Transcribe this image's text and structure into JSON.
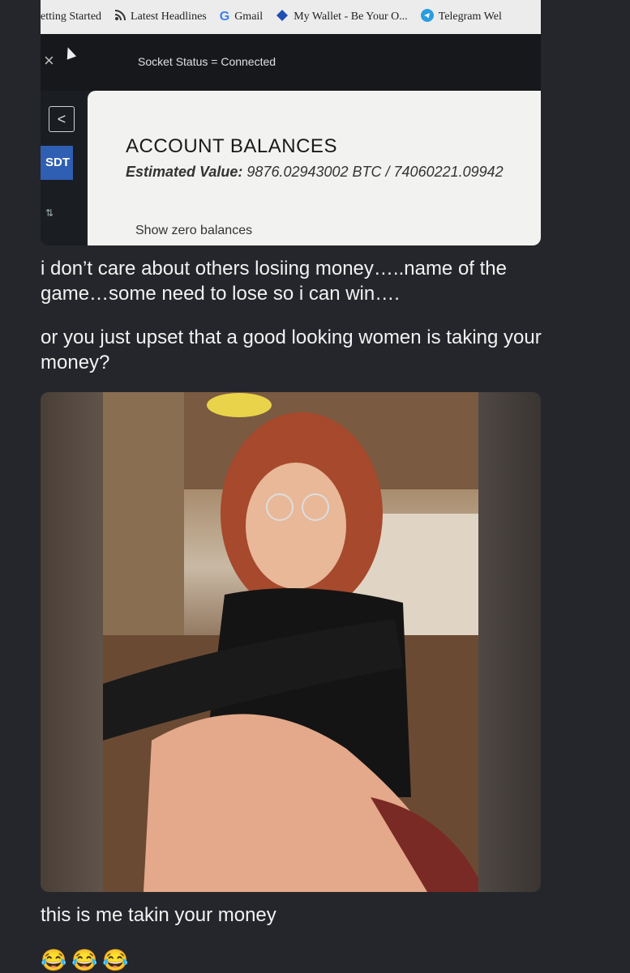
{
  "bookmarks": [
    {
      "label": "etting Started",
      "icon": "none"
    },
    {
      "label": "Latest Headlines",
      "icon": "rss-icon"
    },
    {
      "label": "Gmail",
      "icon": "google-icon"
    },
    {
      "label": "My Wallet - Be Your O...",
      "icon": "diamond-icon"
    },
    {
      "label": "Telegram Wel",
      "icon": "telegram-icon"
    }
  ],
  "exchange": {
    "socket_status": "Socket Status = Connected",
    "pair_tab": "SDT",
    "title": "ACCOUNT BALANCES",
    "estimated_label": "Estimated Value:",
    "estimated_value": "9876.02943002 BTC / 74060221.09942",
    "show_zero": "Show zero balances"
  },
  "messages": {
    "m1": "i don’t care about others losiing money…..name of the game…some need to lose so i can win….",
    "m2": "or you just upset that a good looking women is taking your money?",
    "m3": "this is me takin your money",
    "emoji": [
      "😂",
      "😂",
      "😂"
    ]
  }
}
